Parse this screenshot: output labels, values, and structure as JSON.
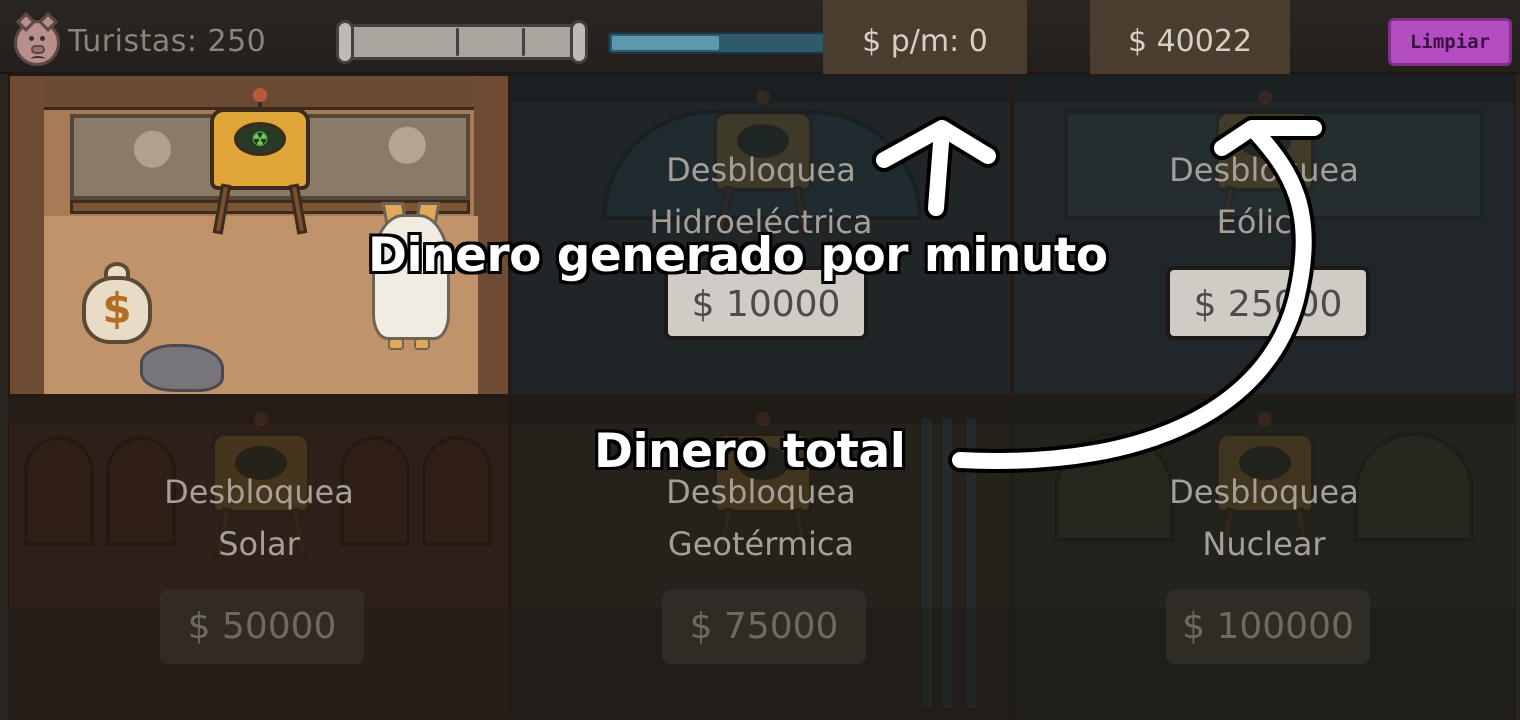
{
  "hud": {
    "tourists_label": "Turistas: 250",
    "money_per_minute": "$ p/m: 0",
    "total_money": "$ 40022",
    "clear_button": "Limpiar",
    "energy_bar_level": 0.48
  },
  "tiles": [
    {
      "unlocked": true,
      "icons": [
        "nuclear-machine",
        "money-bag",
        "ghost-cat",
        "rock"
      ]
    },
    {
      "unlocked": false,
      "label": "Desbloquea",
      "name": "Hidroeléctrica",
      "price": "$ 10000",
      "affordable": true
    },
    {
      "unlocked": false,
      "label": "Desbloquea",
      "name": "Eólica",
      "price": "$ 25000",
      "affordable": true
    },
    {
      "unlocked": false,
      "label": "Desbloquea",
      "name": "Solar",
      "price": "$ 50000",
      "affordable": false
    },
    {
      "unlocked": false,
      "label": "Desbloquea",
      "name": "Geotérmica",
      "price": "$ 75000",
      "affordable": false
    },
    {
      "unlocked": false,
      "label": "Desbloquea",
      "name": "Nuclear",
      "price": "$ 100000",
      "affordable": false
    }
  ],
  "annotations": {
    "money_per_minute": "Dinero generado por minuto",
    "total_money": "Dinero total"
  },
  "colors": {
    "clear_button": "#b44dc2",
    "stat_panel": "#4a3d30",
    "energy_bar": "#5f97ad"
  }
}
